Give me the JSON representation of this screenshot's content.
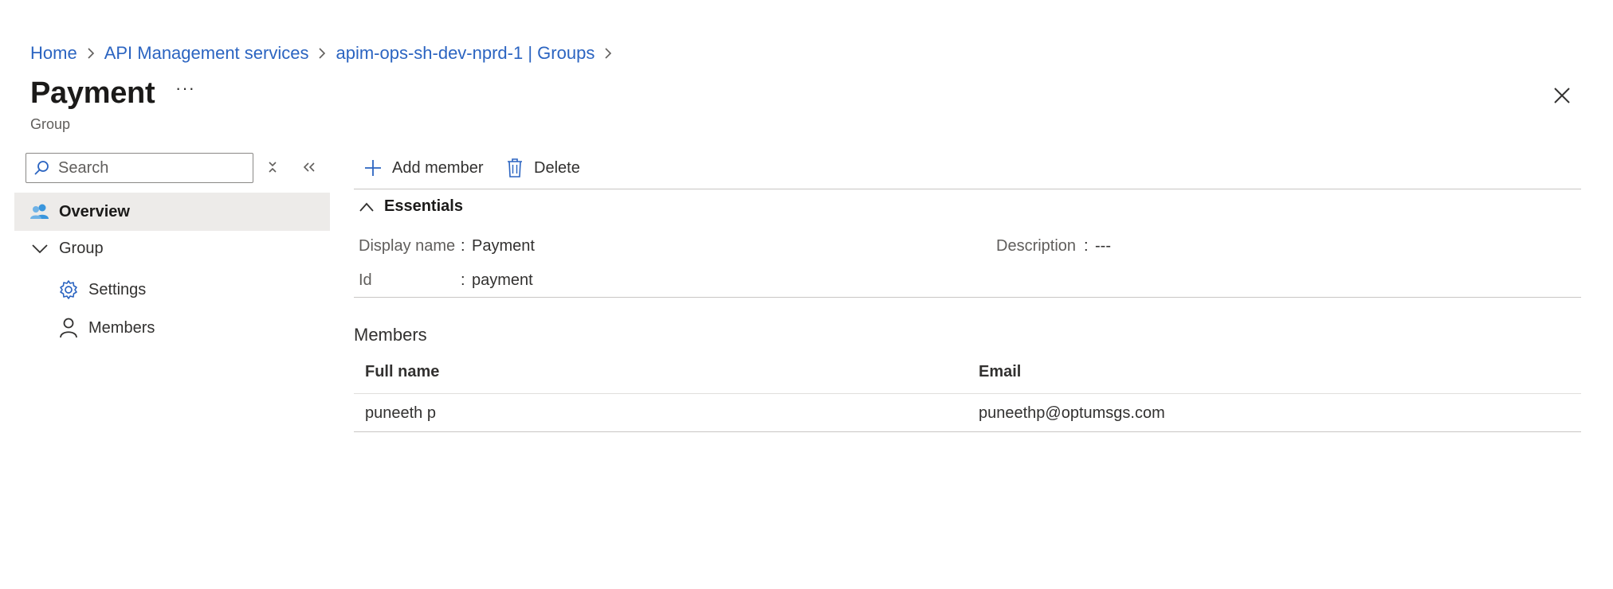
{
  "breadcrumb": {
    "items": [
      "Home",
      "API Management services",
      "apim-ops-sh-dev-nprd-1 | Groups"
    ]
  },
  "header": {
    "title": "Payment",
    "more": "···",
    "subtitle": "Group"
  },
  "sidebar": {
    "search_placeholder": "Search",
    "items": [
      {
        "label": "Overview",
        "icon": "people-icon",
        "selected": true
      },
      {
        "label": "Group",
        "icon": "chevron-down-icon",
        "expanded": true
      },
      {
        "label": "Settings",
        "icon": "gear-icon"
      },
      {
        "label": "Members",
        "icon": "person-icon"
      }
    ]
  },
  "toolbar": {
    "add_member_label": "Add member",
    "delete_label": "Delete"
  },
  "essentials": {
    "title": "Essentials",
    "display_name_label": "Display name",
    "display_name_value": "Payment",
    "id_label": "Id",
    "id_value": "payment",
    "description_label": "Description",
    "description_value": "---",
    "colon": ":"
  },
  "members": {
    "title": "Members",
    "columns": [
      "Full name",
      "Email"
    ],
    "rows": [
      {
        "full_name": "puneeth p",
        "email": "puneethp@optumsgs.com"
      }
    ]
  },
  "colors": {
    "link": "#2b64c1",
    "accent": "#0f6cbd",
    "selected_bg": "#edebe9",
    "divider": "#c8c6c4"
  }
}
